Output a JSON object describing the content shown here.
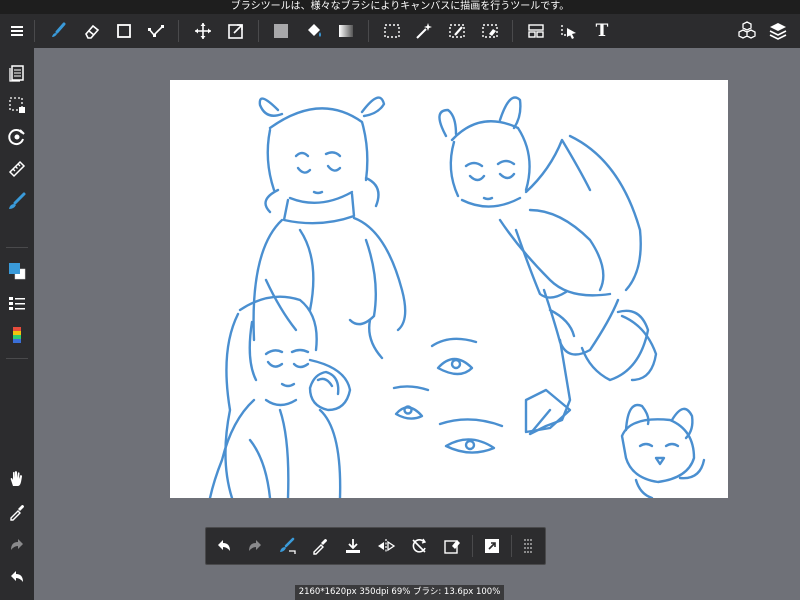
{
  "status_bar": {
    "text": "ブラシツールは、様々なブラシによりキャンバスに描画を行うツールです。"
  },
  "top_toolbar": {
    "items": [
      {
        "name": "menu-icon"
      },
      {
        "name": "brush-icon",
        "active": true
      },
      {
        "name": "eraser-icon"
      },
      {
        "name": "shape-rectangle-icon"
      },
      {
        "name": "stroke-points-icon"
      },
      {
        "name": "move-icon"
      },
      {
        "name": "transform-icon"
      },
      {
        "name": "fill-color-icon"
      },
      {
        "name": "bucket-icon"
      },
      {
        "name": "gradient-icon"
      },
      {
        "name": "select-rectangle-icon"
      },
      {
        "name": "magic-wand-icon"
      },
      {
        "name": "select-pen-icon"
      },
      {
        "name": "select-eraser-icon"
      },
      {
        "name": "frame-divider-icon"
      },
      {
        "name": "operation-icon"
      },
      {
        "name": "text-icon",
        "glyph": "T"
      },
      {
        "name": "3d-material-icon"
      },
      {
        "name": "layers-icon"
      }
    ]
  },
  "left_toolbar": {
    "items": [
      {
        "name": "page-manager-icon"
      },
      {
        "name": "selection-icon"
      },
      {
        "name": "snap-icon"
      },
      {
        "name": "ruler-icon"
      },
      {
        "name": "brush-settings-icon"
      },
      {
        "name": "color-swatch-icon"
      },
      {
        "name": "brush-list-icon"
      },
      {
        "name": "color-palette-icon"
      },
      {
        "name": "hand-icon"
      },
      {
        "name": "eyedropper-icon"
      },
      {
        "name": "redo-icon"
      },
      {
        "name": "undo-icon"
      }
    ]
  },
  "bottom_toolbar": {
    "items": [
      {
        "name": "undo-icon"
      },
      {
        "name": "redo-icon"
      },
      {
        "name": "stabilizer-brush-icon"
      },
      {
        "name": "eyedropper-icon"
      },
      {
        "name": "save-icon"
      },
      {
        "name": "flip-horizontal-icon"
      },
      {
        "name": "rotate-reset-icon"
      },
      {
        "name": "erase-layer-icon"
      },
      {
        "name": "fullscreen-icon"
      },
      {
        "name": "more-icon"
      }
    ]
  },
  "info_bar": {
    "text": "2160*1620px 350dpi 69% ブラシ: 13.6px 100%"
  },
  "colors": {
    "accent": "#3a9ad9",
    "toolbar_bg": "#2c2c2e",
    "workspace_bg": "#6f7178",
    "canvas_bg": "#ffffff",
    "sketch_stroke": "#4a8fd0"
  }
}
